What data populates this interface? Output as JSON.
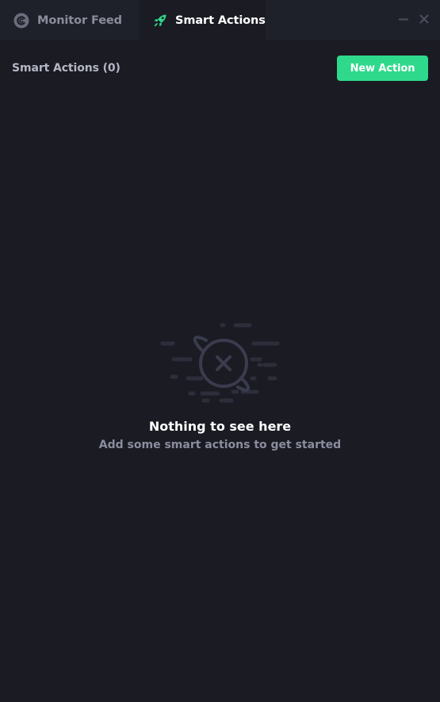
{
  "tabs": [
    {
      "label": "Monitor Feed",
      "icon": "monitor-feed-icon",
      "active": false
    },
    {
      "label": "Smart Actions",
      "icon": "rocket-icon",
      "active": true
    }
  ],
  "window_controls": {
    "minimize_icon": "minimize-icon",
    "close_icon": "close-icon"
  },
  "header": {
    "title": "Smart Actions (0)",
    "new_action_label": "New Action"
  },
  "empty_state": {
    "icon": "planet-x-icon",
    "title": "Nothing to see here",
    "subtitle": "Add some smart actions to get started"
  },
  "colors": {
    "background": "#1a1b23",
    "tabbar": "#1f212a",
    "accent": "#2fd98b",
    "muted_text": "#8b8d9c",
    "illustration": "#34364a"
  }
}
